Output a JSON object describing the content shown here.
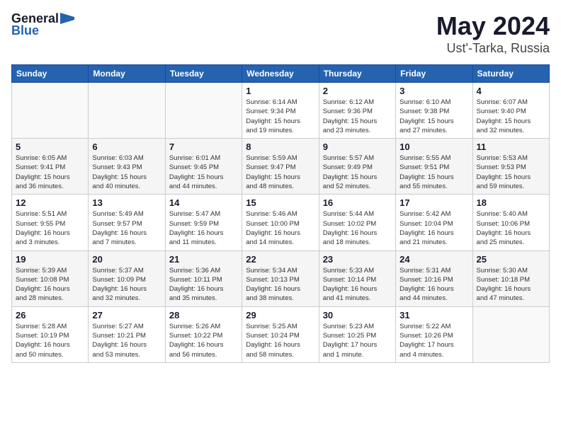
{
  "header": {
    "logo_general": "General",
    "logo_blue": "Blue",
    "title": "May 2024",
    "location": "Ust'-Tarka, Russia"
  },
  "weekdays": [
    "Sunday",
    "Monday",
    "Tuesday",
    "Wednesday",
    "Thursday",
    "Friday",
    "Saturday"
  ],
  "weeks": [
    [
      {
        "day": "",
        "info": ""
      },
      {
        "day": "",
        "info": ""
      },
      {
        "day": "",
        "info": ""
      },
      {
        "day": "1",
        "info": "Sunrise: 6:14 AM\nSunset: 9:34 PM\nDaylight: 15 hours\nand 19 minutes."
      },
      {
        "day": "2",
        "info": "Sunrise: 6:12 AM\nSunset: 9:36 PM\nDaylight: 15 hours\nand 23 minutes."
      },
      {
        "day": "3",
        "info": "Sunrise: 6:10 AM\nSunset: 9:38 PM\nDaylight: 15 hours\nand 27 minutes."
      },
      {
        "day": "4",
        "info": "Sunrise: 6:07 AM\nSunset: 9:40 PM\nDaylight: 15 hours\nand 32 minutes."
      }
    ],
    [
      {
        "day": "5",
        "info": "Sunrise: 6:05 AM\nSunset: 9:41 PM\nDaylight: 15 hours\nand 36 minutes."
      },
      {
        "day": "6",
        "info": "Sunrise: 6:03 AM\nSunset: 9:43 PM\nDaylight: 15 hours\nand 40 minutes."
      },
      {
        "day": "7",
        "info": "Sunrise: 6:01 AM\nSunset: 9:45 PM\nDaylight: 15 hours\nand 44 minutes."
      },
      {
        "day": "8",
        "info": "Sunrise: 5:59 AM\nSunset: 9:47 PM\nDaylight: 15 hours\nand 48 minutes."
      },
      {
        "day": "9",
        "info": "Sunrise: 5:57 AM\nSunset: 9:49 PM\nDaylight: 15 hours\nand 52 minutes."
      },
      {
        "day": "10",
        "info": "Sunrise: 5:55 AM\nSunset: 9:51 PM\nDaylight: 15 hours\nand 55 minutes."
      },
      {
        "day": "11",
        "info": "Sunrise: 5:53 AM\nSunset: 9:53 PM\nDaylight: 15 hours\nand 59 minutes."
      }
    ],
    [
      {
        "day": "12",
        "info": "Sunrise: 5:51 AM\nSunset: 9:55 PM\nDaylight: 16 hours\nand 3 minutes."
      },
      {
        "day": "13",
        "info": "Sunrise: 5:49 AM\nSunset: 9:57 PM\nDaylight: 16 hours\nand 7 minutes."
      },
      {
        "day": "14",
        "info": "Sunrise: 5:47 AM\nSunset: 9:59 PM\nDaylight: 16 hours\nand 11 minutes."
      },
      {
        "day": "15",
        "info": "Sunrise: 5:46 AM\nSunset: 10:00 PM\nDaylight: 16 hours\nand 14 minutes."
      },
      {
        "day": "16",
        "info": "Sunrise: 5:44 AM\nSunset: 10:02 PM\nDaylight: 16 hours\nand 18 minutes."
      },
      {
        "day": "17",
        "info": "Sunrise: 5:42 AM\nSunset: 10:04 PM\nDaylight: 16 hours\nand 21 minutes."
      },
      {
        "day": "18",
        "info": "Sunrise: 5:40 AM\nSunset: 10:06 PM\nDaylight: 16 hours\nand 25 minutes."
      }
    ],
    [
      {
        "day": "19",
        "info": "Sunrise: 5:39 AM\nSunset: 10:08 PM\nDaylight: 16 hours\nand 28 minutes."
      },
      {
        "day": "20",
        "info": "Sunrise: 5:37 AM\nSunset: 10:09 PM\nDaylight: 16 hours\nand 32 minutes."
      },
      {
        "day": "21",
        "info": "Sunrise: 5:36 AM\nSunset: 10:11 PM\nDaylight: 16 hours\nand 35 minutes."
      },
      {
        "day": "22",
        "info": "Sunrise: 5:34 AM\nSunset: 10:13 PM\nDaylight: 16 hours\nand 38 minutes."
      },
      {
        "day": "23",
        "info": "Sunrise: 5:33 AM\nSunset: 10:14 PM\nDaylight: 16 hours\nand 41 minutes."
      },
      {
        "day": "24",
        "info": "Sunrise: 5:31 AM\nSunset: 10:16 PM\nDaylight: 16 hours\nand 44 minutes."
      },
      {
        "day": "25",
        "info": "Sunrise: 5:30 AM\nSunset: 10:18 PM\nDaylight: 16 hours\nand 47 minutes."
      }
    ],
    [
      {
        "day": "26",
        "info": "Sunrise: 5:28 AM\nSunset: 10:19 PM\nDaylight: 16 hours\nand 50 minutes."
      },
      {
        "day": "27",
        "info": "Sunrise: 5:27 AM\nSunset: 10:21 PM\nDaylight: 16 hours\nand 53 minutes."
      },
      {
        "day": "28",
        "info": "Sunrise: 5:26 AM\nSunset: 10:22 PM\nDaylight: 16 hours\nand 56 minutes."
      },
      {
        "day": "29",
        "info": "Sunrise: 5:25 AM\nSunset: 10:24 PM\nDaylight: 16 hours\nand 58 minutes."
      },
      {
        "day": "30",
        "info": "Sunrise: 5:23 AM\nSunset: 10:25 PM\nDaylight: 17 hours\nand 1 minute."
      },
      {
        "day": "31",
        "info": "Sunrise: 5:22 AM\nSunset: 10:26 PM\nDaylight: 17 hours\nand 4 minutes."
      },
      {
        "day": "",
        "info": ""
      }
    ]
  ]
}
